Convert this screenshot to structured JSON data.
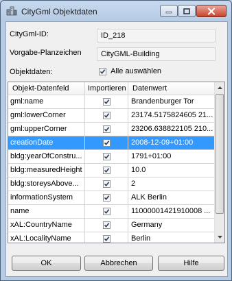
{
  "window": {
    "title": "CityGml Objektdaten",
    "icon": "city-buildings-icon"
  },
  "form": {
    "id_label": "CityGml-ID:",
    "id_value": "ID_218",
    "planzeichen_label": "Vorgabe-Planzeichen",
    "planzeichen_value": "CityGML-Building",
    "objektdaten_label": "Objektdaten:",
    "select_all_label": "Alle auswählen",
    "select_all_checked": true
  },
  "table": {
    "columns": [
      "Objekt-Datenfeld",
      "Importieren",
      "Datenwert"
    ],
    "rows": [
      {
        "field": "gml:name",
        "import": true,
        "value": "Brandenburger Tor",
        "selected": false
      },
      {
        "field": "gml:lowerCorner",
        "import": true,
        "value": "23174.5175824605 21...",
        "selected": false
      },
      {
        "field": "gml:upperCorner",
        "import": true,
        "value": "23206.638822105 210...",
        "selected": false
      },
      {
        "field": "creationDate",
        "import": true,
        "value": "2008-12-09+01:00",
        "selected": true
      },
      {
        "field": "bldg:yearOfConstru...",
        "import": true,
        "value": "1791+01:00",
        "selected": false
      },
      {
        "field": "bldg:measuredHeight",
        "import": true,
        "value": "10.0",
        "selected": false
      },
      {
        "field": "bldg:storeysAbove...",
        "import": true,
        "value": "2",
        "selected": false
      },
      {
        "field": "informationSystem",
        "import": true,
        "value": "ALK Berlin",
        "selected": false
      },
      {
        "field": "name",
        "import": true,
        "value": "11000001421910008  ...",
        "selected": false
      },
      {
        "field": "xAL:CountryName",
        "import": true,
        "value": "Germany",
        "selected": false
      },
      {
        "field": "xAL:LocalityName",
        "import": true,
        "value": "Berlin",
        "selected": false
      }
    ]
  },
  "buttons": {
    "ok": "OK",
    "cancel": "Abbrechen",
    "help": "Hilfe"
  },
  "colors": {
    "selection": "#3399ff",
    "close_button": "#c8452f"
  }
}
